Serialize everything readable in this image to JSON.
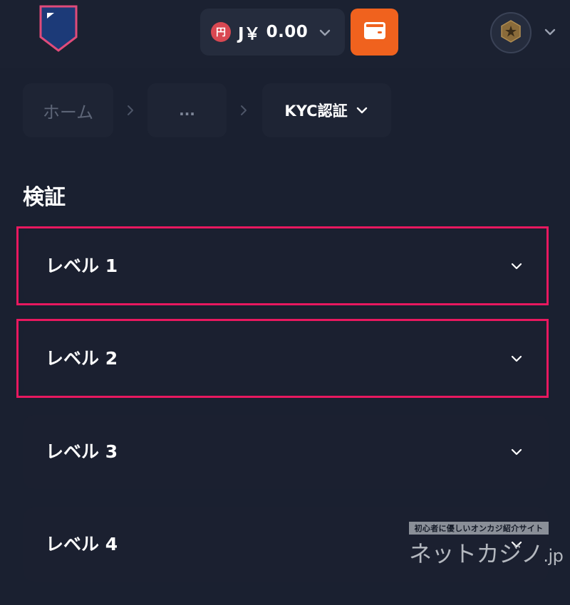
{
  "header": {
    "balance": {
      "badge": "円",
      "currency": "J￥",
      "amount": "0.00"
    },
    "icons": {
      "logo": "shield-logo",
      "wallet": "wallet-icon",
      "avatar": "star-medal-icon",
      "chevron": "chevron-down-icon"
    }
  },
  "breadcrumb": {
    "home": "ホーム",
    "ellipsis": "...",
    "current": "KYC認証"
  },
  "page": {
    "title": "検証"
  },
  "levels": [
    {
      "label": "レベル 1",
      "highlighted": true
    },
    {
      "label": "レベル 2",
      "highlighted": true
    },
    {
      "label": "レベル 3",
      "highlighted": false
    },
    {
      "label": "レベル 4",
      "highlighted": false
    }
  ],
  "watermark": {
    "tagline": "初心者に優しいオンカジ紹介サイト",
    "brand": "ネットカジノ",
    "tld": ".jp"
  },
  "colors": {
    "background": "#1a2030",
    "wallet_accent": "#f0621e",
    "highlight": "#e8185f",
    "yen_badge": "#d94852"
  }
}
